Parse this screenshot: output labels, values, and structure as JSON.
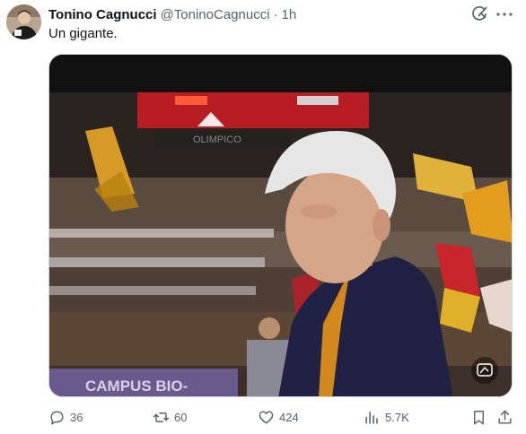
{
  "tweet": {
    "author_name": "Tonino Cagnucci",
    "handle": "@ToninoCagnucci",
    "separator": "·",
    "time": "1h",
    "text": "Un gigante."
  },
  "media": {
    "scoreboard_text": "OLIMPICO",
    "banner_text": "CAMPUS BIO-"
  },
  "actions": {
    "replies": "36",
    "reposts": "60",
    "likes": "424",
    "views": "5.7K"
  },
  "icons": {
    "reply": "reply-icon",
    "repost": "repost-icon",
    "like": "heart-icon",
    "views": "views-icon",
    "bookmark": "bookmark-icon",
    "share": "share-icon",
    "grok": "grok-icon",
    "alt": "alt-text-icon"
  },
  "colors": {
    "text_primary": "#0f1419",
    "text_secondary": "#536471",
    "border": "#cfd9de"
  }
}
